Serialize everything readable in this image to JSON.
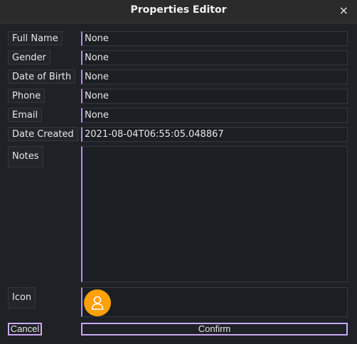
{
  "window": {
    "title": "Properties Editor",
    "close_glyph": "×"
  },
  "fields": [
    {
      "label": "Full Name",
      "value": "None"
    },
    {
      "label": "Gender",
      "value": "None"
    },
    {
      "label": "Date of Birth",
      "value": "None"
    },
    {
      "label": "Phone",
      "value": "None"
    },
    {
      "label": "Email",
      "value": "None"
    },
    {
      "label": "Date Created",
      "value": "2021-08-04T06:55:05.048867"
    }
  ],
  "notes": {
    "label": "Notes",
    "value": ""
  },
  "icon": {
    "label": "Icon",
    "name": "user-icon",
    "color": "#ffa10a"
  },
  "buttons": {
    "cancel": "Cancel",
    "confirm": "Confirm"
  },
  "colors": {
    "accent": "#b48ef0",
    "background": "#1e2125"
  }
}
